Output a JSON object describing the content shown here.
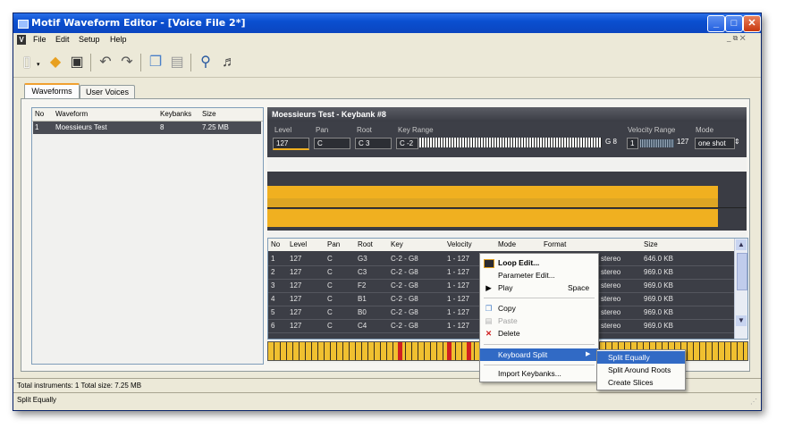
{
  "window": {
    "title": "Motif Waveform Editor - [Voice File 2*]"
  },
  "menu": {
    "items": [
      "File",
      "Edit",
      "Setup",
      "Help"
    ],
    "mdi_controls": "_ ♬ ✕"
  },
  "toolbar": {
    "icons": [
      "new-icon",
      "open-icon",
      "save-icon",
      "undo-icon",
      "redo-icon",
      "copy-icon",
      "paste-icon",
      "find-icon",
      "audition-icon"
    ]
  },
  "tabs": [
    {
      "label": "Waveforms",
      "active": true
    },
    {
      "label": "User Voices",
      "active": false
    }
  ],
  "waveform_list": {
    "columns": [
      "No",
      "Waveform",
      "Keybanks",
      "Size"
    ],
    "rows": [
      {
        "no": "1",
        "name": "Moessieurs Test",
        "keybanks": "8",
        "size": "7.25 MB"
      }
    ]
  },
  "keybank_panel": {
    "title": "Moessieurs Test - Keybank #8",
    "labels": {
      "level": "Level",
      "pan": "Pan",
      "root": "Root",
      "key_range": "Key Range",
      "velocity_range": "Velocity Range",
      "mode": "Mode"
    },
    "values": {
      "level": "127",
      "pan": "C",
      "root": "C 3",
      "key_low": "C -2",
      "key_high": "G 8",
      "vel_low": "1",
      "vel_high": "127",
      "mode": "one shot"
    }
  },
  "keybank_table": {
    "columns": [
      "No",
      "Level",
      "Pan",
      "Root",
      "Key",
      "Velocity",
      "Mode",
      "Format",
      "Size"
    ],
    "rows": [
      {
        "no": "1",
        "level": "127",
        "pan": "C",
        "root": "G3",
        "key": "C-2 - G8",
        "velocity": "1 - 127",
        "format": "stereo",
        "size": "646.0 KB"
      },
      {
        "no": "2",
        "level": "127",
        "pan": "C",
        "root": "C3",
        "key": "C-2 - G8",
        "velocity": "1 - 127",
        "format": "stereo",
        "size": "969.0 KB"
      },
      {
        "no": "3",
        "level": "127",
        "pan": "C",
        "root": "F2",
        "key": "C-2 - G8",
        "velocity": "1 - 127",
        "format": "stereo",
        "size": "969.0 KB"
      },
      {
        "no": "4",
        "level": "127",
        "pan": "C",
        "root": "B1",
        "key": "C-2 - G8",
        "velocity": "1 - 127",
        "format": "stereo",
        "size": "969.0 KB"
      },
      {
        "no": "5",
        "level": "127",
        "pan": "C",
        "root": "B0",
        "key": "C-2 - G8",
        "velocity": "1 - 127",
        "format": "stereo",
        "size": "969.0 KB"
      },
      {
        "no": "6",
        "level": "127",
        "pan": "C",
        "root": "C4",
        "key": "C-2 - G8",
        "velocity": "1 - 127",
        "format": "stereo",
        "size": "969.0 KB"
      }
    ]
  },
  "context_menu": {
    "items": [
      {
        "label": "Loop Edit...",
        "bold": true
      },
      {
        "label": "Parameter Edit..."
      },
      {
        "label": "Play",
        "shortcut": "Space"
      },
      {
        "label": "Copy"
      },
      {
        "label": "Paste",
        "disabled": true
      },
      {
        "label": "Delete"
      },
      {
        "label": "Keyboard Split",
        "submenu": true
      },
      {
        "label": "Import Keybanks..."
      }
    ]
  },
  "submenu": {
    "items": [
      "Split Equally",
      "Split Around Roots",
      "Create Slices"
    ]
  },
  "status": {
    "info": "Total instruments: 1   Total size: 7.25 MB",
    "hint": "Split Equally"
  },
  "colors": {
    "title_bar": "#0a4fd0",
    "accent": "#f0b020",
    "selection": "#316ac5",
    "panel_dark": "#3d3f47"
  }
}
